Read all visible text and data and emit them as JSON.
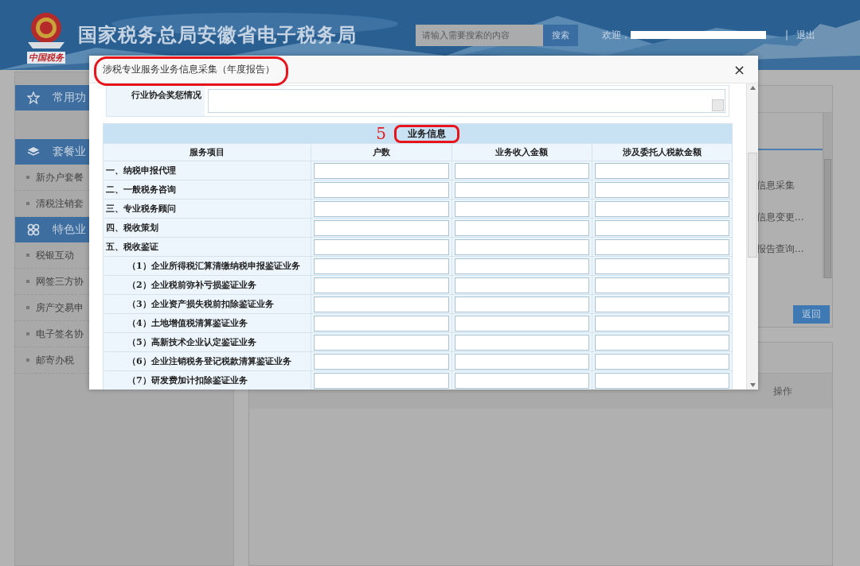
{
  "header": {
    "logo_text": "中国税务",
    "title": "国家税务总局安徽省电子税务局",
    "search": {
      "placeholder": "请输入需要搜索的内容",
      "button": "搜索"
    },
    "welcome": "欢迎，",
    "separator": "|",
    "logout": "退出"
  },
  "sidebar": {
    "sections": [
      {
        "title": "常用功"
      },
      {
        "title": "套餐业",
        "items": [
          "新办户套餐",
          "清税注销套"
        ]
      },
      {
        "title": "特色业",
        "items": [
          "税银互动",
          "网签三方协",
          "房产交易申",
          "电子签名协",
          "邮寄办税"
        ]
      }
    ]
  },
  "content": {
    "links": [
      "信息采集",
      "信息变更...",
      "报告查询..."
    ],
    "back_button": "返回",
    "list_header": {
      "column_4": "操作"
    }
  },
  "modal": {
    "title": "涉税专业服务业务信息采集（年度报告）",
    "close": "×",
    "field": {
      "label": "行业协会奖惩情况"
    },
    "section": {
      "number": "5",
      "title": "业务信息"
    },
    "columns": [
      "服务项目",
      "户数",
      "业务收入金额",
      "涉及委托人税款金额"
    ],
    "rows": [
      {
        "label": "一、纳税申报代理",
        "kind": "category"
      },
      {
        "label": "二、一般税务咨询",
        "kind": "category"
      },
      {
        "label": "三、专业税务顾问",
        "kind": "category"
      },
      {
        "label": "四、税收策划",
        "kind": "category"
      },
      {
        "label": "五、税收鉴证",
        "kind": "category"
      },
      {
        "label": "（1）企业所得税汇算清缴纳税申报鉴证业务",
        "kind": "sub"
      },
      {
        "label": "（2）企业税前弥补亏损鉴证业务",
        "kind": "sub"
      },
      {
        "label": "（3）企业资产损失税前扣除鉴证业务",
        "kind": "sub"
      },
      {
        "label": "（4）土地增值税清算鉴证业务",
        "kind": "sub"
      },
      {
        "label": "（5）高新技术企业认定鉴证业务",
        "kind": "sub"
      },
      {
        "label": "（6）企业注销税务登记税款清算鉴证业务",
        "kind": "sub"
      },
      {
        "label": "（7）研发费加计扣除鉴证业务",
        "kind": "sub"
      }
    ]
  }
}
